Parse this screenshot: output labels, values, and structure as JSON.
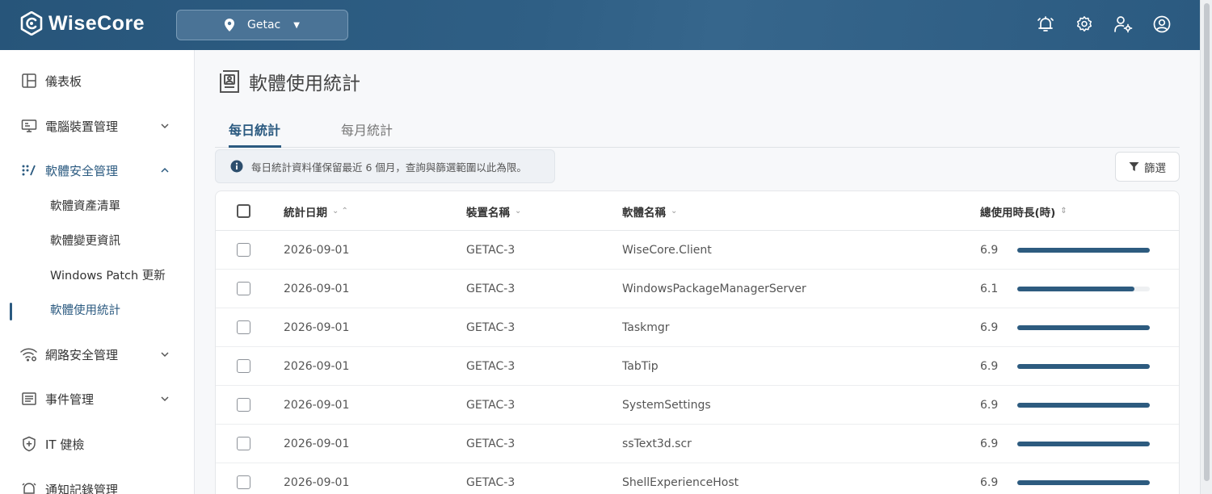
{
  "app": {
    "name": "WiseCore"
  },
  "header": {
    "site_selector": "Getac",
    "icons": [
      "bell-icon",
      "gear-icon",
      "user-settings-icon",
      "account-icon"
    ]
  },
  "sidebar": {
    "items": [
      {
        "label": "儀表板",
        "icon": "dashboard-icon"
      },
      {
        "label": "電腦裝置管理",
        "icon": "device-icon"
      },
      {
        "label": "軟體安全管理",
        "icon": "software-security-icon"
      },
      {
        "label": "網路安全管理",
        "icon": "network-icon"
      },
      {
        "label": "事件管理",
        "icon": "event-icon"
      },
      {
        "label": "IT 健檢",
        "icon": "shield-plus-icon"
      },
      {
        "label": "通知記錄管理",
        "icon": "notification-icon"
      }
    ],
    "sub_items": [
      "軟體資產清單",
      "軟體變更資訊",
      "Windows Patch 更新",
      "軟體使用統計"
    ]
  },
  "page": {
    "title": "軟體使用統計",
    "tabs": [
      "每日統計",
      "每月統計"
    ],
    "info": "每日統計資料僅保留最近 6 個月，查詢與篩選範圍以此為限。",
    "filter_label": "篩選"
  },
  "table": {
    "columns": [
      "統計日期",
      "裝置名稱",
      "軟體名稱",
      "總使用時長(時)"
    ],
    "max_hours": 6.9,
    "rows": [
      {
        "date": "2026-09-01",
        "device": "GETAC-3",
        "software": "WiseCore.Client",
        "hours": "6.9",
        "fraction": 1.0
      },
      {
        "date": "2026-09-01",
        "device": "GETAC-3",
        "software": "WindowsPackageManagerServer",
        "hours": "6.1",
        "fraction": 0.884
      },
      {
        "date": "2026-09-01",
        "device": "GETAC-3",
        "software": "Taskmgr",
        "hours": "6.9",
        "fraction": 1.0
      },
      {
        "date": "2026-09-01",
        "device": "GETAC-3",
        "software": "TabTip",
        "hours": "6.9",
        "fraction": 1.0
      },
      {
        "date": "2026-09-01",
        "device": "GETAC-3",
        "software": "SystemSettings",
        "hours": "6.9",
        "fraction": 1.0
      },
      {
        "date": "2026-09-01",
        "device": "GETAC-3",
        "software": "ssText3d.scr",
        "hours": "6.9",
        "fraction": 1.0
      },
      {
        "date": "2026-09-01",
        "device": "GETAC-3",
        "software": "ShellExperienceHost",
        "hours": "6.9",
        "fraction": 1.0
      }
    ]
  },
  "colors": {
    "primary": "#2b5a80",
    "header": "#2d5b80",
    "bar": "#2d5b7f"
  }
}
